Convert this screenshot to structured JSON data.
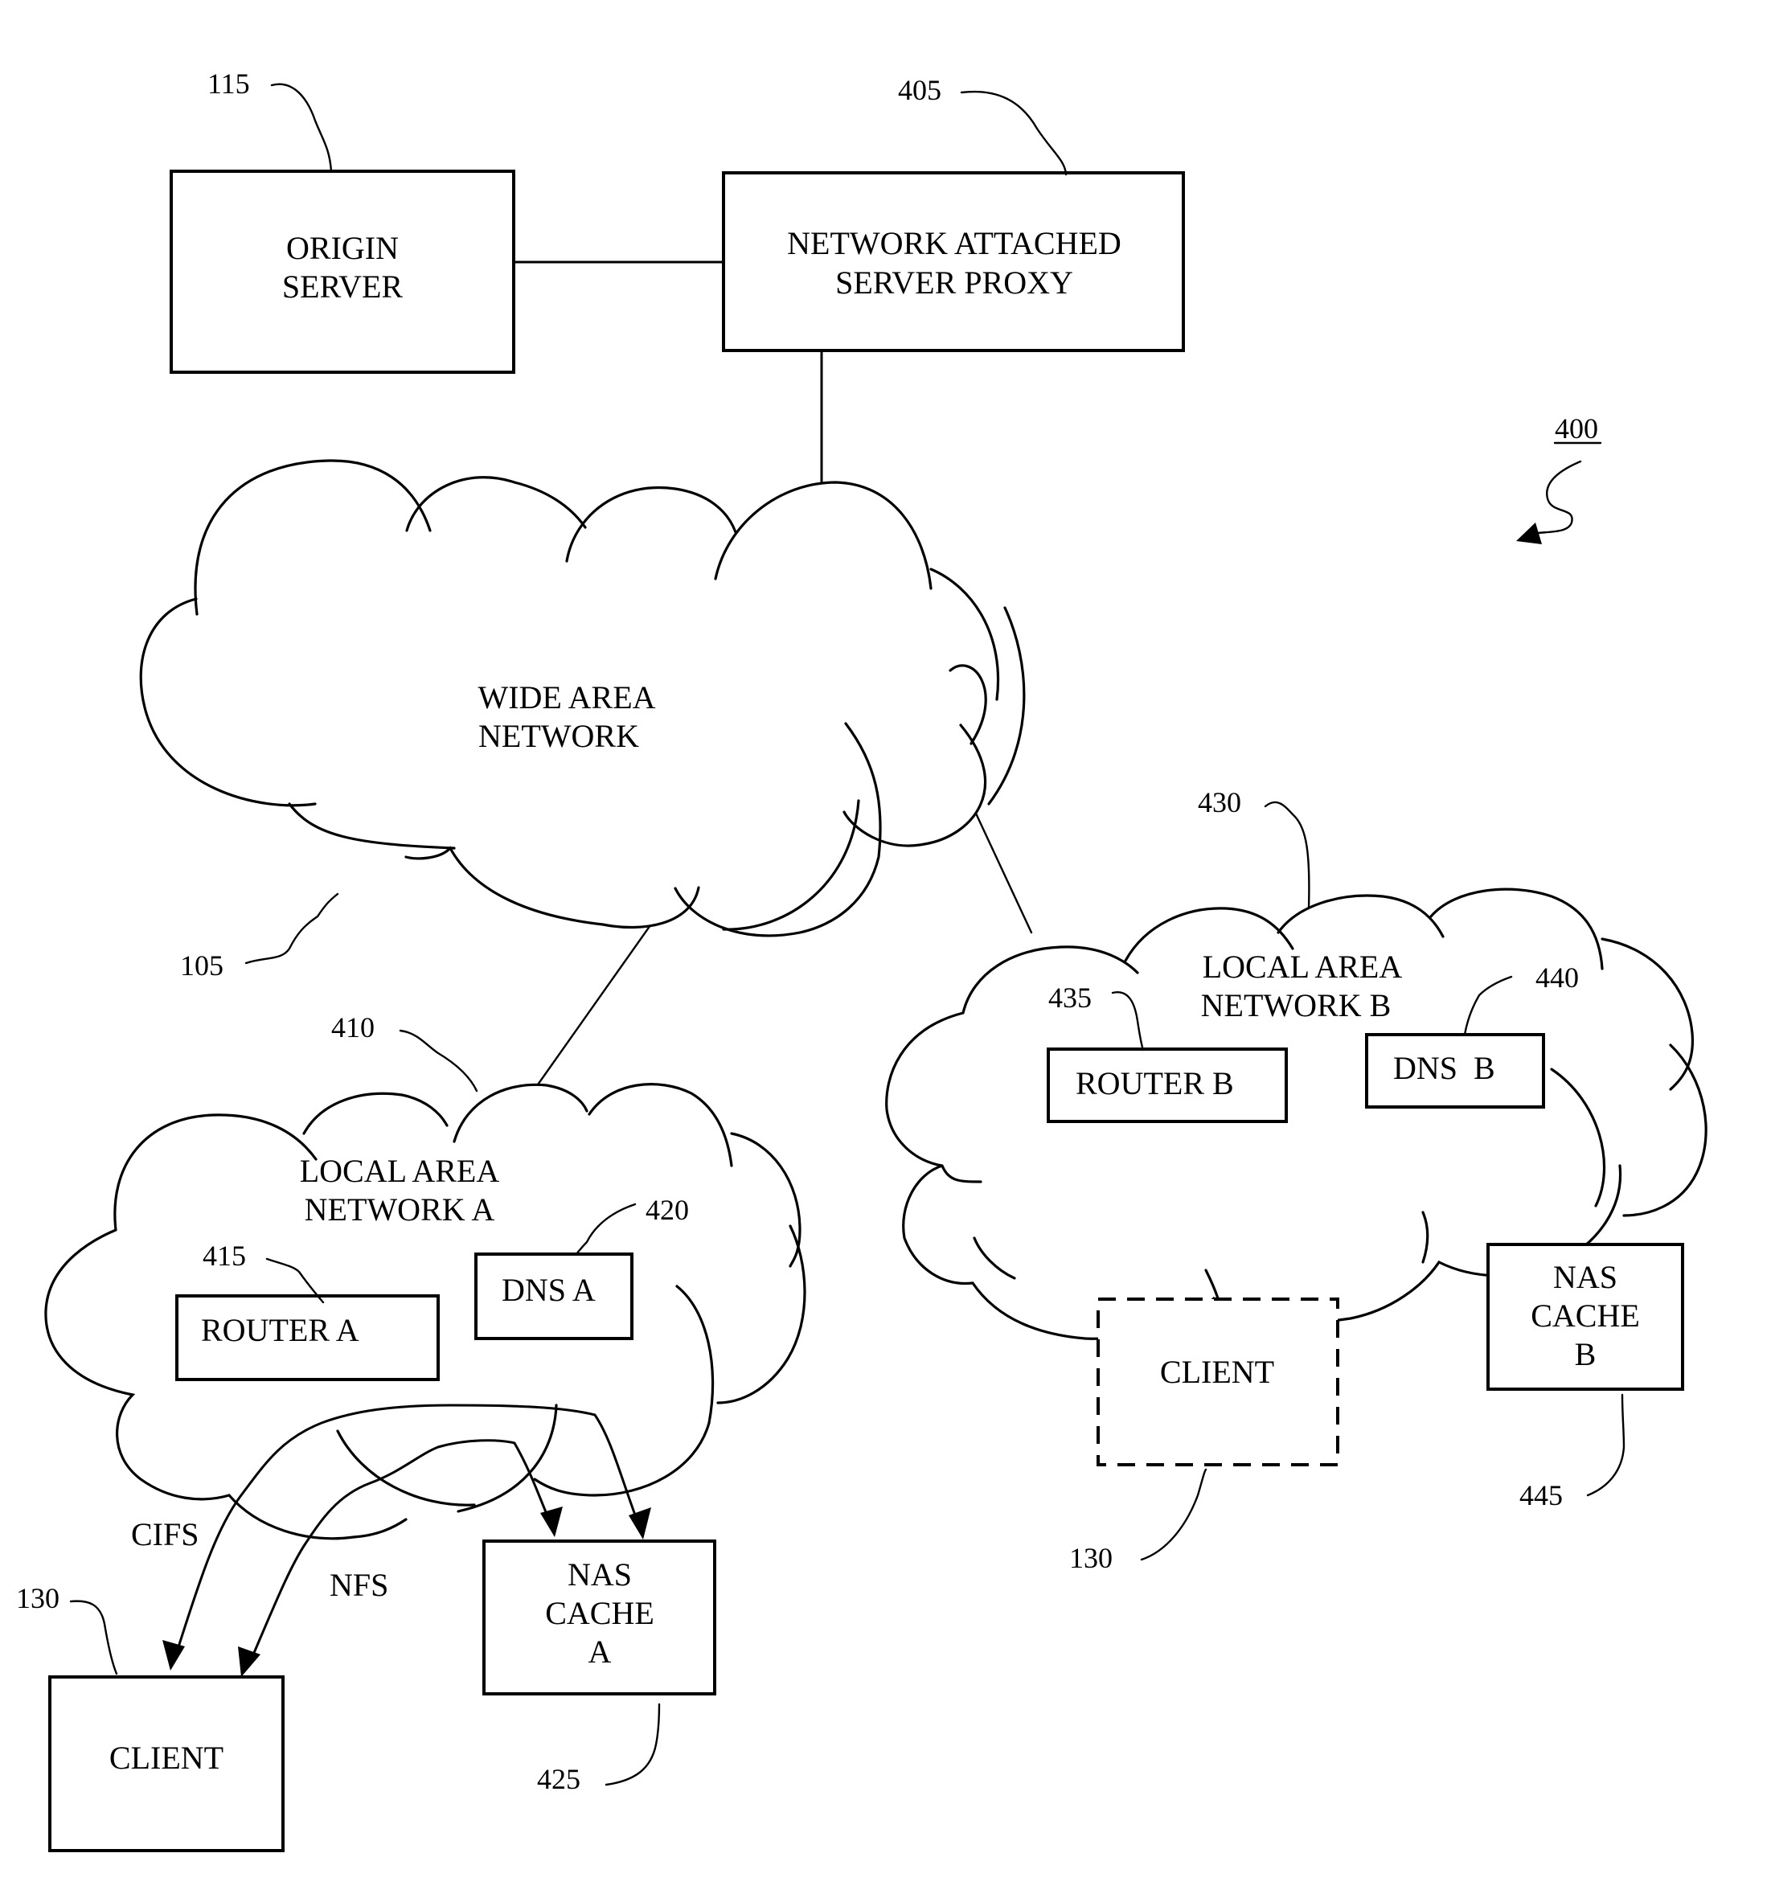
{
  "figure": {
    "reference": "400"
  },
  "nodes": {
    "origin_server": {
      "ref": "115",
      "lines": [
        "ORIGIN",
        "SERVER"
      ]
    },
    "nas_proxy": {
      "ref": "405",
      "lines": [
        "NETWORK ATTACHED",
        "SERVER PROXY"
      ]
    },
    "wan": {
      "ref": "105",
      "lines": [
        "WIDE AREA",
        "NETWORK"
      ]
    },
    "lan_a": {
      "ref": "410",
      "lines": [
        "LOCAL AREA",
        "NETWORK A"
      ]
    },
    "router_a": {
      "ref": "415",
      "lines": [
        "ROUTER A"
      ]
    },
    "dns_a": {
      "ref": "420",
      "lines": [
        "DNS A"
      ]
    },
    "nas_cache_a": {
      "ref": "425",
      "lines": [
        "NAS",
        "CACHE",
        "A"
      ]
    },
    "client_a": {
      "ref": "130",
      "lines": [
        "CLIENT"
      ]
    },
    "lan_b": {
      "ref": "430",
      "lines": [
        "LOCAL AREA",
        "NETWORK B"
      ]
    },
    "router_b": {
      "ref": "435",
      "lines": [
        "ROUTER B"
      ]
    },
    "dns_b": {
      "ref": "440",
      "lines": [
        "DNS  B"
      ]
    },
    "nas_cache_b": {
      "ref": "445",
      "lines": [
        "NAS",
        "CACHE",
        "B"
      ]
    },
    "client_b": {
      "ref": "130",
      "lines": [
        "CLIENT"
      ],
      "style": "dashed"
    }
  },
  "protocols": {
    "cifs": "CIFS",
    "nfs": "NFS"
  },
  "edges": [
    {
      "from": "origin_server",
      "to": "nas_proxy",
      "style": "solid"
    },
    {
      "from": "nas_proxy",
      "to": "wan",
      "style": "solid"
    },
    {
      "from": "wan",
      "to": "lan_a",
      "style": "solid"
    },
    {
      "from": "wan",
      "to": "lan_b",
      "style": "solid"
    },
    {
      "from": "lan_b",
      "to": "client_b",
      "style": "dashed"
    },
    {
      "from": "lan_b",
      "to": "nas_cache_b",
      "style": "solid"
    },
    {
      "from": "nas_cache_a",
      "to": "client_a",
      "style": "bidirectional-arrow",
      "label": "CIFS"
    },
    {
      "from": "nas_cache_a",
      "to": "client_a",
      "style": "bidirectional-arrow",
      "label": "NFS"
    }
  ]
}
